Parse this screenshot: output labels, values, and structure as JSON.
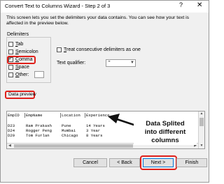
{
  "window": {
    "title": "Convert Text to Columns Wizard - Step 2 of 3",
    "help_icon": "?",
    "close_icon": "✕"
  },
  "intro_text": "This screen lets you set the delimiters your data contains.  You can see how your text is affected in the preview below.",
  "delimiters": {
    "label": "Delimiters",
    "options": [
      {
        "name": "tab",
        "label_u": "T",
        "label_rest": "ab",
        "checked": false
      },
      {
        "name": "semicolon",
        "label_u": "S",
        "label_rest": "emicolon",
        "checked": false
      },
      {
        "name": "comma",
        "label_u": "C",
        "label_rest": "omma",
        "checked": true
      },
      {
        "name": "space",
        "label_u": "S",
        "label_rest": "pace",
        "checked": false
      },
      {
        "name": "other",
        "label_u": "O",
        "label_rest": "ther:",
        "checked": false
      }
    ],
    "other_value": ""
  },
  "consecutive": {
    "label_u": "T",
    "label_rest": "reat consecutive delimiters as one",
    "checked": false
  },
  "text_qualifier": {
    "label": "Text qualifier:",
    "value": "\""
  },
  "preview": {
    "label": "Data preview",
    "header": [
      "EmpID",
      "EmpName",
      "Location",
      "Experience"
    ],
    "rows": [
      [
        "D23",
        "Ram Prakash",
        "Pune",
        "14 Years"
      ],
      [
        "D24",
        "Rogger Peng",
        "Mumbai",
        "3 Year"
      ],
      [
        "D29",
        "Tom Furlan",
        "Chicago",
        "8 Years"
      ]
    ]
  },
  "annotation": {
    "line1": "Data Splited",
    "line2": "into different",
    "line3": "columns"
  },
  "buttons": {
    "cancel": "Cancel",
    "back": "< Back",
    "next": "Next >",
    "finish": "Finish"
  },
  "colors": {
    "highlight": "#e0201a",
    "header_row": "#c4d3e8",
    "dialog_bg": "#f0f0f0"
  }
}
